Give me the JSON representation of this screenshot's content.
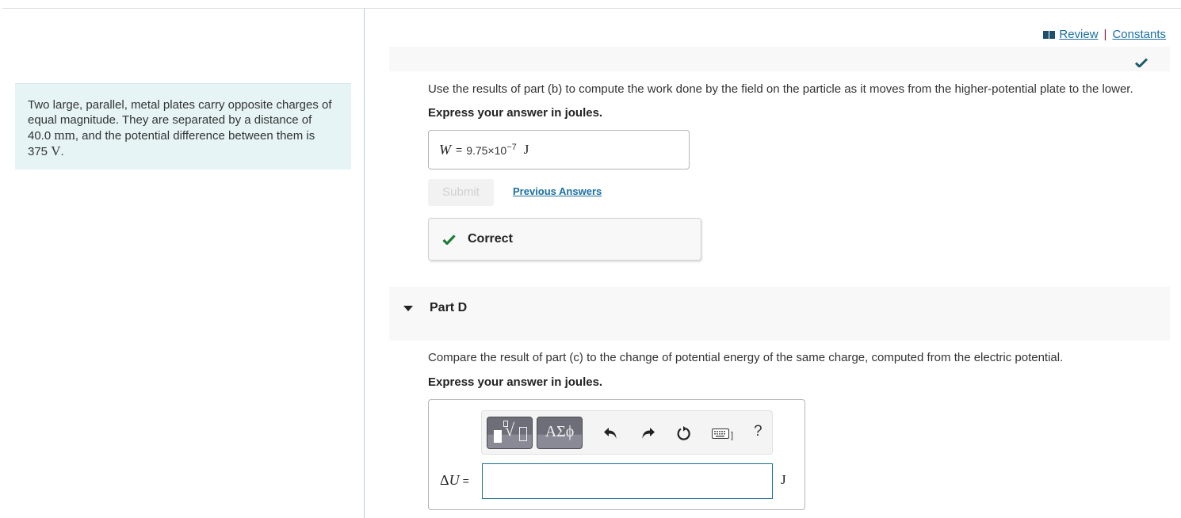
{
  "problem": {
    "text_before_distance": "Two large, parallel, metal plates carry opposite charges of equal magnitude. They are separated by a distance of ",
    "distance_value": "40.0",
    "distance_unit": "mm",
    "text_before_voltage": ", and the potential difference between them is ",
    "voltage_value": "375",
    "voltage_unit": "V",
    "text_end": "."
  },
  "header": {
    "review_icon": "book-icon",
    "review_label": " Review",
    "separator": "|",
    "constants_label": "Constants"
  },
  "part_c": {
    "status_icon": "checkmark-icon",
    "question": "Use the results of part (b) to compute the work done by the field on the particle as it moves from the higher-potential plate to the lower.",
    "instruction": "Express your answer in joules.",
    "answer": {
      "variable": "W",
      "equals": "=",
      "mantissa": "9.75×10",
      "exponent": "−7",
      "unit": "J"
    },
    "submit_label": "Submit",
    "previous_answers_label": "Previous Answers",
    "feedback": {
      "icon": "green-check-icon",
      "text": "Correct",
      "color": "#1e7b3c"
    }
  },
  "part_d": {
    "caret_icon": "caret-down-icon",
    "title": "Part D",
    "question": "Compare the result of part (c) to the change of potential energy of the same charge, computed from the electric potential.",
    "instruction": "Express your answer in joules.",
    "toolbar": {
      "templates_icon": "templates-root-icon",
      "greek_label": "ΑΣϕ",
      "undo_icon": "undo-icon",
      "redo_icon": "redo-icon",
      "reset_icon": "reset-icon",
      "keyboard_icon": "keyboard-icon",
      "keyboard_suffix": "]",
      "help_label": "?"
    },
    "input": {
      "label_delta": "Δ",
      "label_var": "U",
      "label_eq": "=",
      "value": "",
      "placeholder": "",
      "unit": "J"
    }
  },
  "colors": {
    "link": "#1a6fa3",
    "intro_bg": "#e6f4f6",
    "check_dark": "#1e5a6e",
    "check_green": "#1e7b3c",
    "input_border": "#1a6f94"
  }
}
